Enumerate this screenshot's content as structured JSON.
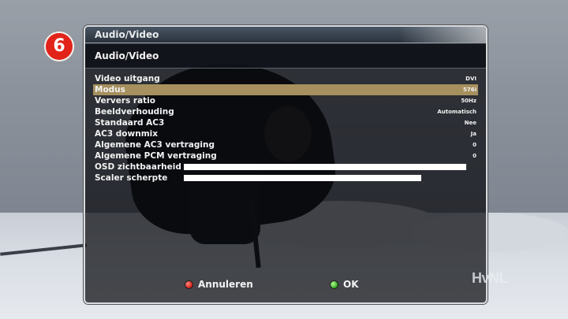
{
  "channel_logo": {
    "text": "6",
    "icon": "channel-6-logo"
  },
  "window": {
    "title": "Audio/Video"
  },
  "panel": {
    "header": "Audio/Video"
  },
  "settings": [
    {
      "label": "Video uitgang",
      "value": "DVI"
    },
    {
      "label": "Modus",
      "value": "576i",
      "selected": true
    },
    {
      "label": "Ververs ratio",
      "value": "50Hz"
    },
    {
      "label": "Beeldverhouding",
      "value": "Automatisch"
    },
    {
      "label": "Standaard AC3",
      "value": "Nee"
    },
    {
      "label": "AC3 downmix",
      "value": "Ja"
    },
    {
      "label": "Algemene AC3 vertraging",
      "value": "0"
    },
    {
      "label": "Algemene PCM vertraging",
      "value": "0"
    },
    {
      "label": "OSD zichtbaarheid",
      "level_fraction": 1.0
    },
    {
      "label": "Scaler scherpte",
      "level_fraction": 0.84
    }
  ],
  "footer": {
    "cancel_label": "Annuleren",
    "ok_label": "OK",
    "cancel_color": "#d01c12",
    "ok_color": "#2fa81c"
  },
  "watermark": {
    "text": "HvNL"
  },
  "colors": {
    "selected_row": "#a6905e",
    "bar": "#ffffff"
  }
}
